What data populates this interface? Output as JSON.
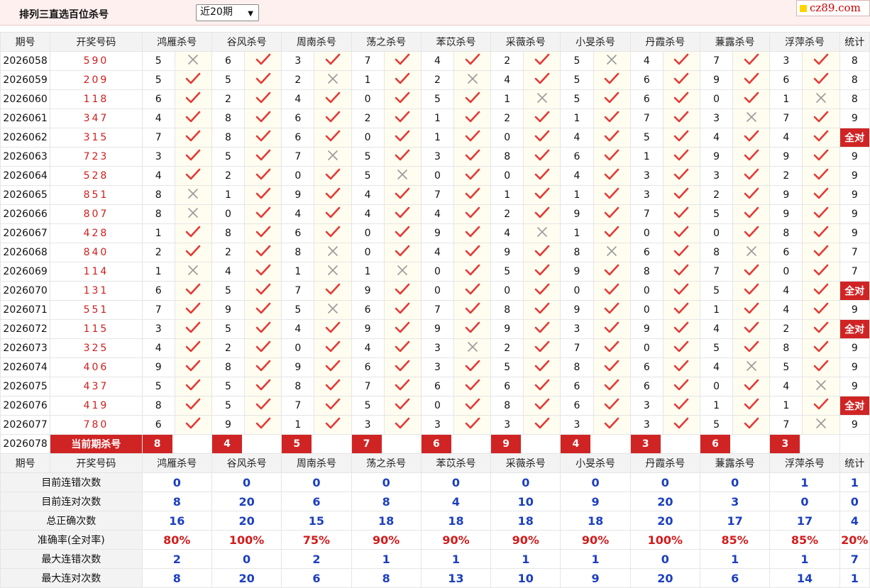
{
  "page": {
    "title": "排列三直选百位杀号",
    "select_value": "近20期",
    "brand": "cz89.com"
  },
  "columns": {
    "issue": "期号",
    "draw": "开奖号码",
    "stat": "统计",
    "experts": [
      "鸿雁杀号",
      "谷风杀号",
      "周南杀号",
      "荡之杀号",
      "苯苡杀号",
      "采薇杀号",
      "小旻杀号",
      "丹霞杀号",
      "蒹露杀号",
      "浮萍杀号"
    ]
  },
  "rows": [
    {
      "issue": "2026058",
      "draw": "590",
      "kills": [
        5,
        6,
        3,
        7,
        4,
        2,
        5,
        4,
        7,
        3
      ],
      "marks": "xvvvvvxvvv",
      "stat": "8"
    },
    {
      "issue": "2026059",
      "draw": "209",
      "kills": [
        5,
        5,
        2,
        1,
        2,
        4,
        5,
        6,
        9,
        6
      ],
      "marks": "vvxvxvvvvv",
      "stat": "8"
    },
    {
      "issue": "2026060",
      "draw": "118",
      "kills": [
        6,
        2,
        4,
        0,
        5,
        1,
        5,
        6,
        0,
        1
      ],
      "marks": "vvvvvxvvvx",
      "stat": "8"
    },
    {
      "issue": "2026061",
      "draw": "347",
      "kills": [
        4,
        8,
        6,
        2,
        1,
        2,
        1,
        7,
        3,
        7
      ],
      "marks": "vvvvvvvvxv",
      "stat": "9"
    },
    {
      "issue": "2026062",
      "draw": "315",
      "kills": [
        7,
        8,
        6,
        0,
        1,
        0,
        4,
        5,
        4,
        4
      ],
      "marks": "vvvvvvvvvv",
      "stat": "全对"
    },
    {
      "issue": "2026063",
      "draw": "723",
      "kills": [
        3,
        5,
        7,
        5,
        3,
        8,
        6,
        1,
        9,
        9
      ],
      "marks": "vvxvvvvvvv",
      "stat": "9"
    },
    {
      "issue": "2026064",
      "draw": "528",
      "kills": [
        4,
        2,
        0,
        5,
        0,
        0,
        4,
        3,
        3,
        2
      ],
      "marks": "vvvxvvvvvv",
      "stat": "9"
    },
    {
      "issue": "2026065",
      "draw": "851",
      "kills": [
        8,
        1,
        9,
        4,
        7,
        1,
        1,
        3,
        2,
        9
      ],
      "marks": "xvvvvvvvvv",
      "stat": "9"
    },
    {
      "issue": "2026066",
      "draw": "807",
      "kills": [
        8,
        0,
        4,
        4,
        4,
        2,
        9,
        7,
        5,
        9
      ],
      "marks": "xvvvvvvvvv",
      "stat": "9"
    },
    {
      "issue": "2026067",
      "draw": "428",
      "kills": [
        1,
        8,
        6,
        0,
        9,
        4,
        1,
        0,
        0,
        8
      ],
      "marks": "vvvvvxvvvv",
      "stat": "9"
    },
    {
      "issue": "2026068",
      "draw": "840",
      "kills": [
        2,
        2,
        8,
        0,
        4,
        9,
        8,
        6,
        8,
        6
      ],
      "marks": "vvxvvvxvxv",
      "stat": "7"
    },
    {
      "issue": "2026069",
      "draw": "114",
      "kills": [
        1,
        4,
        1,
        1,
        0,
        5,
        9,
        8,
        7,
        0
      ],
      "marks": "xvxxvvvvvv",
      "stat": "7"
    },
    {
      "issue": "2026070",
      "draw": "131",
      "kills": [
        6,
        5,
        7,
        9,
        0,
        0,
        0,
        0,
        5,
        4
      ],
      "marks": "vvvvvvvvvv",
      "stat": "全对"
    },
    {
      "issue": "2026071",
      "draw": "551",
      "kills": [
        7,
        9,
        5,
        6,
        7,
        8,
        9,
        0,
        1,
        4
      ],
      "marks": "vvxvvvvvvv",
      "stat": "9"
    },
    {
      "issue": "2026072",
      "draw": "115",
      "kills": [
        3,
        5,
        4,
        9,
        9,
        9,
        3,
        9,
        4,
        2
      ],
      "marks": "vvvvvvvvvv",
      "stat": "全对"
    },
    {
      "issue": "2026073",
      "draw": "325",
      "kills": [
        4,
        2,
        0,
        4,
        3,
        2,
        7,
        0,
        5,
        8
      ],
      "marks": "vvvvxvvvvv",
      "stat": "9"
    },
    {
      "issue": "2026074",
      "draw": "406",
      "kills": [
        9,
        8,
        9,
        6,
        3,
        5,
        8,
        6,
        4,
        5
      ],
      "marks": "vvvvvvvvxv",
      "stat": "9"
    },
    {
      "issue": "2026075",
      "draw": "437",
      "kills": [
        5,
        5,
        8,
        7,
        6,
        6,
        6,
        6,
        0,
        4
      ],
      "marks": "vvvvvvvvvx",
      "stat": "9"
    },
    {
      "issue": "2026076",
      "draw": "419",
      "kills": [
        8,
        5,
        7,
        5,
        0,
        8,
        6,
        3,
        1,
        1
      ],
      "marks": "vvvvvvvvvv",
      "stat": "全对"
    },
    {
      "issue": "2026077",
      "draw": "780",
      "kills": [
        6,
        9,
        1,
        3,
        3,
        3,
        3,
        3,
        5,
        7
      ],
      "marks": "vvvvvvvvvx",
      "stat": "9"
    }
  ],
  "current": {
    "issue": "2026078",
    "label": "当前期杀号",
    "kills": [
      8,
      4,
      5,
      7,
      6,
      9,
      4,
      3,
      6,
      3
    ]
  },
  "summary": [
    {
      "label": "目前连错次数",
      "values": [
        "0",
        "0",
        "0",
        "0",
        "0",
        "0",
        "0",
        "0",
        "0",
        "1"
      ],
      "stat": "1",
      "style": "blue"
    },
    {
      "label": "目前连对次数",
      "values": [
        "8",
        "20",
        "6",
        "8",
        "4",
        "10",
        "9",
        "20",
        "3",
        "0"
      ],
      "stat": "0",
      "style": "blue"
    },
    {
      "label": "总正确次数",
      "values": [
        "16",
        "20",
        "15",
        "18",
        "18",
        "18",
        "18",
        "20",
        "17",
        "17"
      ],
      "stat": "4",
      "style": "blue"
    },
    {
      "label": "准确率(全对率)",
      "values": [
        "80%",
        "100%",
        "75%",
        "90%",
        "90%",
        "90%",
        "90%",
        "100%",
        "85%",
        "85%"
      ],
      "stat": "20%",
      "style": "red"
    },
    {
      "label": "最大连错次数",
      "values": [
        "2",
        "0",
        "2",
        "1",
        "1",
        "1",
        "1",
        "0",
        "1",
        "1"
      ],
      "stat": "7",
      "style": "blue"
    },
    {
      "label": "最大连对次数",
      "values": [
        "8",
        "20",
        "6",
        "8",
        "13",
        "10",
        "9",
        "20",
        "6",
        "14"
      ],
      "stat": "1",
      "style": "blue"
    }
  ],
  "colors": {
    "check": "#e53935",
    "cross": "#9a9a9a",
    "accent": "#d02424",
    "value_blue": "#1c3fbf"
  }
}
